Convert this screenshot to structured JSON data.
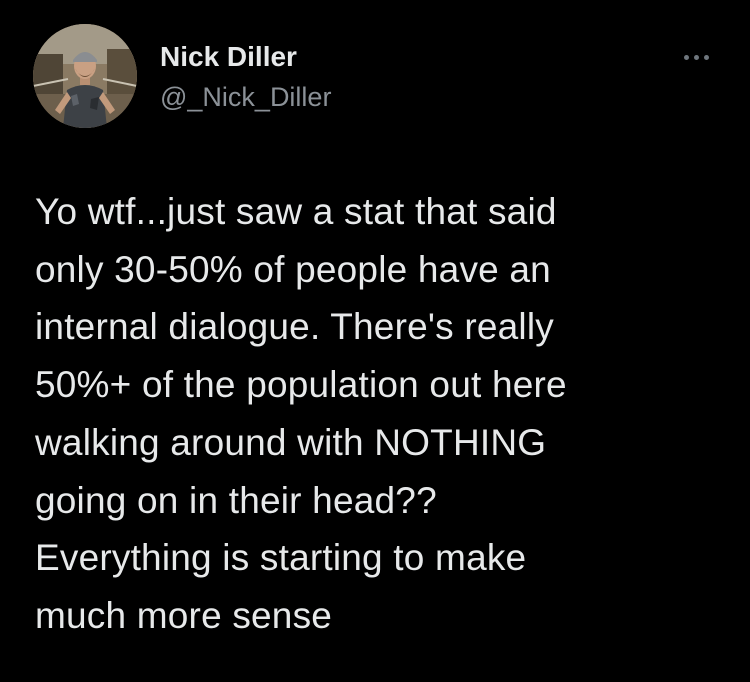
{
  "tweet": {
    "author": {
      "display_name": "Nick Diller",
      "handle": "@_Nick_Diller"
    },
    "text": "Yo wtf...just saw a stat that said\nonly 30-50% of people have an\ninternal dialogue.  There's really\n50%+ of the population out here\nwalking around with NOTHING\ngoing on in their head??\nEverything is starting to make\nmuch more sense"
  },
  "icons": {
    "more_options": "more-horizontal-icon"
  },
  "colors": {
    "background": "#000000",
    "primary_text": "#e7e9ea",
    "secondary_text": "#8b9197"
  }
}
